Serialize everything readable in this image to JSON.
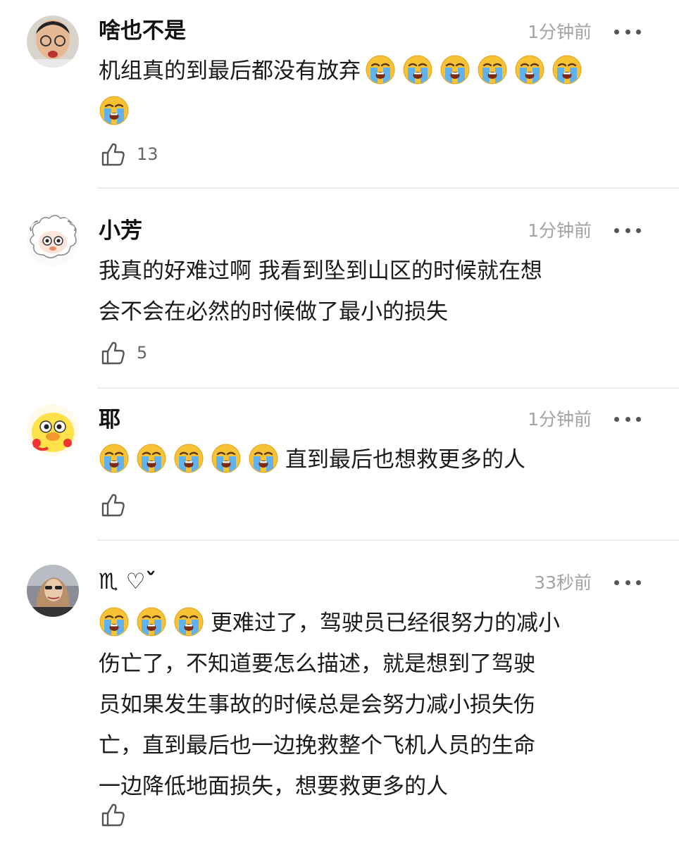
{
  "comments": [
    {
      "username": "啥也不是",
      "time": "1分钟前",
      "text_lines": [
        "机组真的到最后都没有放弃",
        ""
      ],
      "emoji_before": 0,
      "emoji_after_line1": 6,
      "emoji_line2": 1,
      "like_count": "13",
      "emoji": "loudly-crying-face"
    },
    {
      "username": "小芳",
      "time": "1分钟前",
      "text_lines": [
        "我真的好难过啊 我看到坠到山区的时候就在想",
        "会不会在必然的时候做了最小的损失"
      ],
      "like_count": "5"
    },
    {
      "username": "耶",
      "time": "1分钟前",
      "emoji_before": 5,
      "text_lines": [
        "直到最后也想救更多的人"
      ],
      "like_count": ""
    },
    {
      "username": "♏︎ ♡ˇ",
      "time": "33秒前",
      "emoji_before": 3,
      "text_lines": [
        "更难过了，驾驶员已经很努力的减小",
        "伤亡了，不知道要怎么描述，就是想到了驾驶",
        "员如果发生事故的时候总是会努力减小损失伤",
        "亡，直到最后也一边挽救整个飞机人员的生命",
        "一边降低地面损失，想要救更多的人"
      ],
      "like_count": ""
    }
  ],
  "colors": {
    "time": "#a3a3a3",
    "divider": "#ececec",
    "icon": "#555555"
  }
}
